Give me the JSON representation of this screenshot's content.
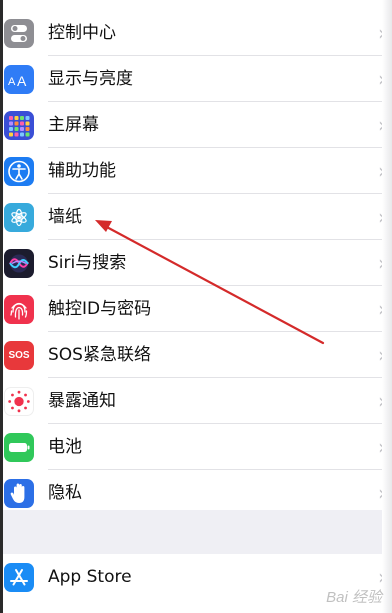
{
  "settings_list": {
    "items": [
      {
        "label": "控制中心",
        "icon": "control-center-icon",
        "color": "#8e8e93"
      },
      {
        "label": "显示与亮度",
        "icon": "display-brightness-icon",
        "color": "#2f7cf6"
      },
      {
        "label": "主屏幕",
        "icon": "home-screen-icon",
        "color": "#3a4fd6"
      },
      {
        "label": "辅助功能",
        "icon": "accessibility-icon",
        "color": "#1d7cf2"
      },
      {
        "label": "墙纸",
        "icon": "wallpaper-icon",
        "color": "#37aadc"
      },
      {
        "label": "Siri与搜索",
        "icon": "siri-icon",
        "color": "#1c1c2e"
      },
      {
        "label": "触控ID与密码",
        "icon": "touch-id-icon",
        "color": "#f0324d"
      },
      {
        "label": "SOS紧急联络",
        "icon": "sos-icon",
        "color": "#e8383b"
      },
      {
        "label": "暴露通知",
        "icon": "exposure-notification-icon",
        "color": "#ffffff"
      },
      {
        "label": "电池",
        "icon": "battery-icon",
        "color": "#30c85a"
      },
      {
        "label": "隐私",
        "icon": "privacy-hand-icon",
        "color": "#2c6fe6"
      }
    ],
    "app_store": {
      "label": "App Store",
      "icon": "app-store-icon",
      "color": "#1a8cf5"
    },
    "sos_icon_text": "SOS"
  },
  "watermark": "Bai 经验",
  "annotation_color": "#d42a2a"
}
